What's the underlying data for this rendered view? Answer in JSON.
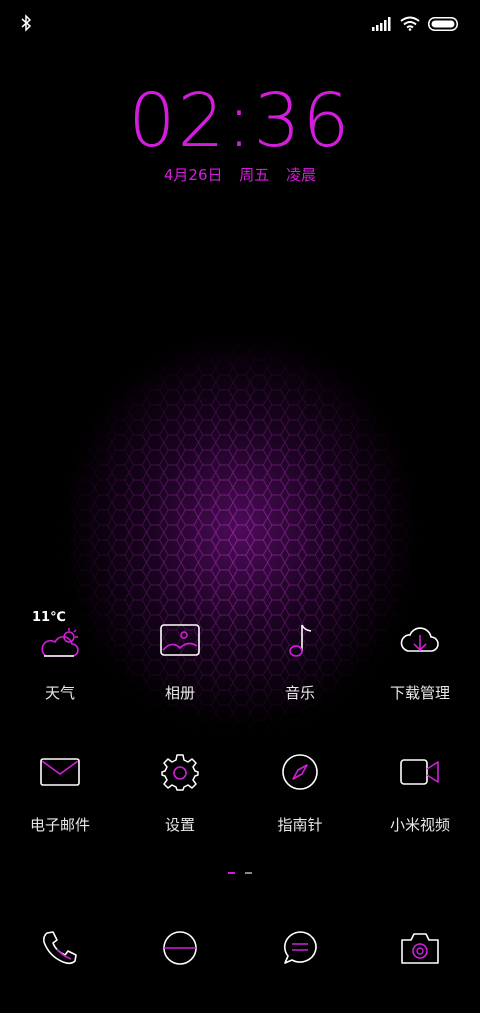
{
  "status": {
    "bluetooth": "bluetooth-icon",
    "signal": "signal-icon",
    "wifi": "wifi-icon",
    "battery": "battery-icon"
  },
  "clock": {
    "time": "02:36",
    "date": "4月26日",
    "weekday": "周五",
    "period": "凌晨"
  },
  "colors": {
    "accent": "#d21edb",
    "icon_stroke": "#ffffff"
  },
  "apps_row1": [
    {
      "label": "天气",
      "icon": "weather-cloud-sun-icon",
      "temp": "11℃"
    },
    {
      "label": "相册",
      "icon": "gallery-icon"
    },
    {
      "label": "音乐",
      "icon": "music-note-icon"
    },
    {
      "label": "下载管理",
      "icon": "cloud-download-icon"
    }
  ],
  "apps_row2": [
    {
      "label": "电子邮件",
      "icon": "mail-icon"
    },
    {
      "label": "设置",
      "icon": "gear-icon"
    },
    {
      "label": "指南针",
      "icon": "compass-icon"
    },
    {
      "label": "小米视频",
      "icon": "video-camera-icon"
    }
  ],
  "pager": {
    "pages": 2,
    "current": 1
  },
  "dock": [
    {
      "icon": "phone-icon"
    },
    {
      "icon": "browser-icon"
    },
    {
      "icon": "messages-icon"
    },
    {
      "icon": "camera-icon"
    }
  ]
}
